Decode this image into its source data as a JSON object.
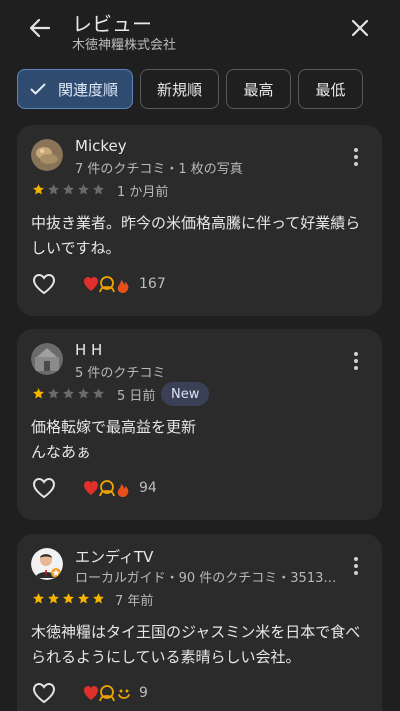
{
  "header": {
    "title": "レビュー",
    "subtitle": "木徳神糧株式会社"
  },
  "filters": {
    "relevance": "関連度順",
    "newest": "新規順",
    "highest": "最高",
    "lowest": "最低"
  },
  "reviews": [
    {
      "name": "Mickey",
      "meta": "7 件のクチコミ・1 枚の写真",
      "rating": 1,
      "when": "1 か月前",
      "text": "中抜き業者。昨今の米価格高騰に伴って好業績らしいですね。",
      "reactions": "167"
    },
    {
      "name": "H H",
      "meta": "5 件のクチコミ",
      "rating": 1,
      "when": "5 日前",
      "badge": "New",
      "text": "価格転嫁で最高益を更新\nんなあぁ",
      "reactions": "94"
    },
    {
      "name": "エンディTV",
      "meta": "ローカルガイド・90 件のクチコミ・3513…",
      "rating": 5,
      "when": "7 年前",
      "text": "木徳神糧はタイ王国のジャスミン米を日本で食べられるようにしている素晴らしい会社。",
      "reactions": "9"
    }
  ],
  "colors": {
    "accent_chip": "#2f4b70",
    "star": "#f4b400",
    "heart": "#e0302b",
    "card": "#2b2b2b"
  }
}
